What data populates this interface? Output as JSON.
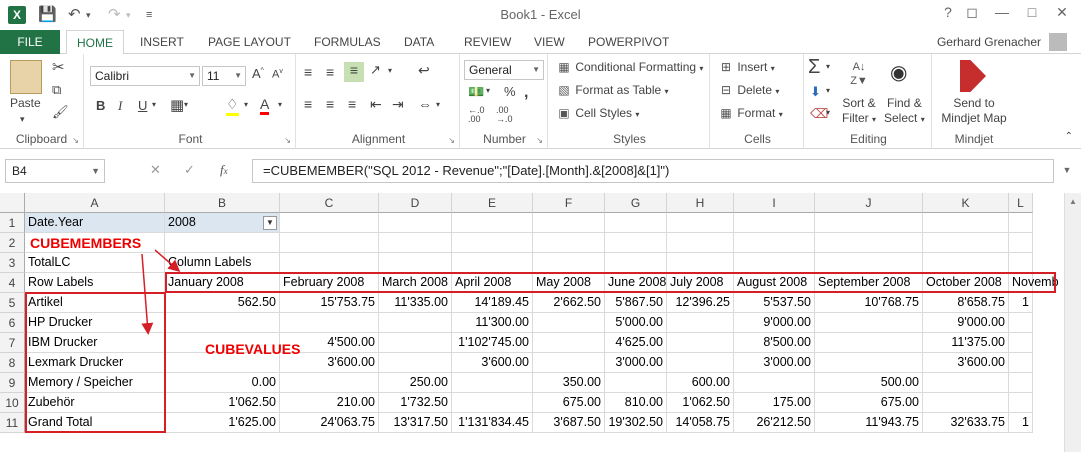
{
  "window": {
    "title": "Book1 - Excel",
    "user": "Gerhard Grenacher"
  },
  "tabs": [
    "FILE",
    "HOME",
    "INSERT",
    "PAGE LAYOUT",
    "FORMULAS",
    "DATA",
    "REVIEW",
    "VIEW",
    "POWERPIVOT"
  ],
  "ribbon": {
    "clipboard": {
      "label": "Clipboard",
      "paste": "Paste"
    },
    "font": {
      "label": "Font",
      "name": "Calibri",
      "size": "11"
    },
    "alignment": {
      "label": "Alignment"
    },
    "number": {
      "label": "Number",
      "format": "General"
    },
    "styles": {
      "label": "Styles",
      "conditional": "Conditional Formatting",
      "format_table": "Format as Table",
      "cell_styles": "Cell Styles"
    },
    "cells": {
      "label": "Cells",
      "insert": "Insert",
      "delete": "Delete",
      "format": "Format"
    },
    "editing": {
      "label": "Editing",
      "sort1": "Sort &",
      "sort2": "Filter",
      "find1": "Find &",
      "find2": "Select"
    },
    "mindjet": {
      "label": "Mindjet",
      "send1": "Send to",
      "send2": "Mindjet Map"
    }
  },
  "formula_bar": {
    "name_box": "B4",
    "formula": "=CUBEMEMBER(\"SQL 2012 - Revenue\";\"[Date].[Month].&[2008]&[1]\")"
  },
  "columns": [
    "A",
    "B",
    "C",
    "D",
    "E",
    "F",
    "G",
    "H",
    "I",
    "J",
    "K",
    "L"
  ],
  "rows": [
    {
      "n": "1",
      "cells": [
        "Date.Year",
        "2008",
        "",
        "",
        "",
        "",
        "",
        "",
        "",
        "",
        "",
        ""
      ]
    },
    {
      "n": "2",
      "cells": [
        "",
        "",
        "",
        "",
        "",
        "",
        "",
        "",
        "",
        "",
        "",
        ""
      ]
    },
    {
      "n": "3",
      "cells": [
        "TotalLC",
        "Column Labels",
        "",
        "",
        "",
        "",
        "",
        "",
        "",
        "",
        "",
        ""
      ]
    },
    {
      "n": "4",
      "cells": [
        "Row Labels",
        "January 2008",
        "February 2008",
        "March 2008",
        "April 2008",
        "May 2008",
        "June 2008",
        "July 2008",
        "August 2008",
        "September 2008",
        "October 2008",
        "Novemb"
      ]
    },
    {
      "n": "5",
      "cells": [
        "Artikel",
        "562.50",
        "15'753.75",
        "11'335.00",
        "14'189.45",
        "2'662.50",
        "5'867.50",
        "12'396.25",
        "5'537.50",
        "10'768.75",
        "8'658.75",
        "1"
      ]
    },
    {
      "n": "6",
      "cells": [
        "HP Drucker",
        "",
        "",
        "",
        "11'300.00",
        "",
        "5'000.00",
        "",
        "9'000.00",
        "",
        "9'000.00",
        ""
      ]
    },
    {
      "n": "7",
      "cells": [
        "IBM Drucker",
        "",
        "4'500.00",
        "",
        "1'102'745.00",
        "",
        "4'625.00",
        "",
        "8'500.00",
        "",
        "11'375.00",
        ""
      ]
    },
    {
      "n": "8",
      "cells": [
        "Lexmark Drucker",
        "",
        "3'600.00",
        "",
        "3'600.00",
        "",
        "3'000.00",
        "",
        "3'000.00",
        "",
        "3'600.00",
        ""
      ]
    },
    {
      "n": "9",
      "cells": [
        "Memory / Speicher",
        "0.00",
        "",
        "250.00",
        "",
        "350.00",
        "",
        "600.00",
        "",
        "500.00",
        "",
        ""
      ]
    },
    {
      "n": "10",
      "cells": [
        "Zubehör",
        "1'062.50",
        "210.00",
        "1'732.50",
        "",
        "675.00",
        "810.00",
        "1'062.50",
        "175.00",
        "675.00",
        "",
        ""
      ]
    },
    {
      "n": "11",
      "cells": [
        "Grand Total",
        "1'625.00",
        "24'063.75",
        "13'317.50",
        "1'131'834.45",
        "3'687.50",
        "19'302.50",
        "14'058.75",
        "26'212.50",
        "11'943.75",
        "32'633.75",
        "1"
      ]
    }
  ],
  "annotations": {
    "cubemembers": "CUBEMEMBERS",
    "cubevalues": "CUBEVALUES"
  },
  "colors": {
    "accent": "#217346",
    "annotation": "#d51f26",
    "selected": "#dce6f1"
  }
}
